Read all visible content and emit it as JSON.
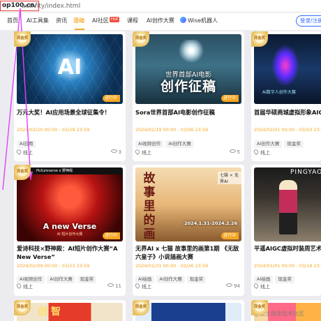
{
  "url": {
    "host": "op100.cn/",
    "path": "activity/index.html"
  },
  "nav": {
    "items": [
      "首页",
      "AI工具集",
      "资讯",
      "活动",
      "AI社区",
      "课程",
      "AI创作大赛",
      "Wise机器人"
    ],
    "hot_badge": "Hot",
    "active": "活动",
    "login": "登录/注册"
  },
  "cards": [
    {
      "badge": "现金奖",
      "status": "进行中",
      "art_text": "AI",
      "title": "万元大奖！AI应用场景全球征集令！",
      "date": "2024/02/20 00:00 - 03/29 23:59",
      "tags": [
        "AI应用"
      ],
      "location": "线上",
      "views": "3"
    },
    {
      "badge": "现金奖",
      "status": "进行中",
      "art_small": "世界首部AI电影",
      "art_big": "创作征稿",
      "title": "Sora世界首部AI电影创作征稿",
      "date": "2024/02/19 00:00 - 03/06 23:59",
      "tags": [
        "AI视频创作",
        "AI创作大赛"
      ],
      "location": "线上",
      "views": "5"
    },
    {
      "badge": "现金奖",
      "art_text": "AI数字人创作大赛",
      "title": "首届华硕商城虚拟形象AIGC",
      "date": "2024/02/01 00:00 - 03/03 23:59",
      "tags": [
        "AI创作大赛",
        "现金奖"
      ],
      "location": "线上",
      "views": ""
    },
    {
      "badge": "现金奖",
      "status": "进行中",
      "art_top": "Pictureverse x 野神殿",
      "art_text": "A new Verse",
      "art_sub": "AI 短片创作大赛",
      "title": "爱诗科技×野神殿：AI短片创作大赛“A New Verse”",
      "date": "2024/02/09 00:00 - 03/23 23:59",
      "tags": [
        "AI视频创作",
        "AI创作大赛",
        "现金奖"
      ],
      "location": "线上",
      "views": "11"
    },
    {
      "badge": "现金奖",
      "status": "进行中",
      "art_vertical": "故事里的画",
      "art_logo": "七猫 × 无界AI",
      "art_date": "2024.1.31-2024.2.26",
      "title": "无界AI x 七猫 故事里的画第1期 《无敌六皇子》小说插画大赛",
      "date": "2024/01/31 00:00 - 02/26 23:59",
      "tags": [
        "AI绘画",
        "AI创作大赛",
        "现金奖"
      ],
      "location": "线上",
      "views": "94"
    },
    {
      "badge": "",
      "art_text": "PINGYAO",
      "title": "平遥AIGC虚拟时装周艺术大",
      "date": "2024/01/01 00:00 - 03/18 23:59",
      "tags": [
        "AI绘画",
        "现金奖"
      ],
      "location": "线上",
      "views": ""
    },
    {
      "badge": "现金奖",
      "art_text": "创 智"
    },
    {
      "badge": "现金奖"
    },
    {
      "badge": "现金奖"
    }
  ],
  "watermark": "@掘土掘金技术社区",
  "annotation": {
    "color": "#e040fb"
  }
}
